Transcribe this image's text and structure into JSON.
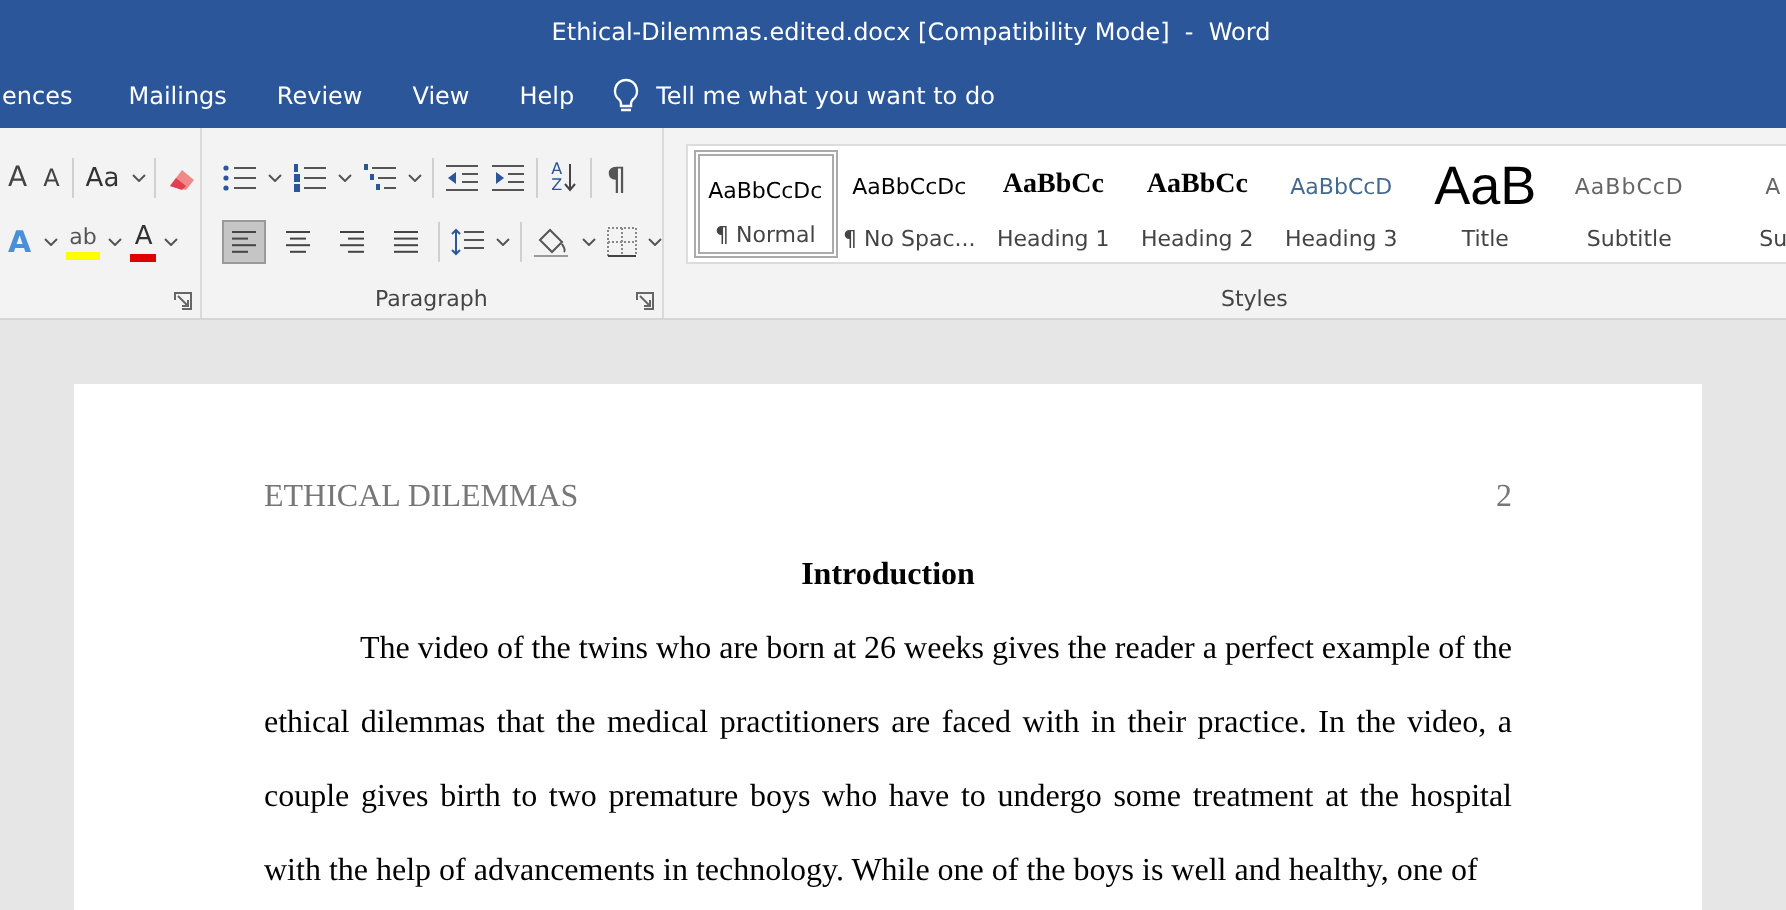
{
  "window": {
    "title": "Ethical-Dilemmas.edited.docx [Compatibility Mode]  -  Word"
  },
  "menu": {
    "tabs": [
      "ences",
      "Mailings",
      "Review",
      "View",
      "Help"
    ],
    "tell_me": "Tell me what you want to do"
  },
  "font_group": {
    "grow_glyph": "A",
    "shrink_glyph": "A",
    "case_label": "Aa",
    "effects_glyph": "A",
    "highlight_glyph": "ab",
    "color_glyph": "A"
  },
  "paragraph_group": {
    "label": "Paragraph",
    "pilcrow": "¶",
    "sort_glyphs": [
      "A",
      "Z"
    ],
    "alignment": [
      {
        "kind": "left",
        "selected": true
      },
      {
        "kind": "center",
        "selected": false
      },
      {
        "kind": "right",
        "selected": false
      },
      {
        "kind": "justify",
        "selected": false
      }
    ]
  },
  "styles_group": {
    "label": "Styles",
    "styles": [
      {
        "preview": "AaBbCcDc",
        "name": "¶ Normal",
        "kind": "normal",
        "selected": true
      },
      {
        "preview": "AaBbCcDc",
        "name": "¶ No Spac...",
        "kind": "normal",
        "selected": false
      },
      {
        "preview": "AaBbCc",
        "name": "Heading 1",
        "kind": "heading1",
        "selected": false
      },
      {
        "preview": "AaBbCc",
        "name": "Heading 2",
        "kind": "heading2",
        "selected": false
      },
      {
        "preview": "AaBbCcD",
        "name": "Heading 3",
        "kind": "heading3",
        "selected": false
      },
      {
        "preview": "AaB",
        "name": "Title",
        "kind": "title",
        "selected": false
      },
      {
        "preview": "AaBbCcD",
        "name": "Subtitle",
        "kind": "subtitle",
        "selected": false
      },
      {
        "preview": "A",
        "name": "Su",
        "kind": "subtitle",
        "selected": false
      }
    ]
  },
  "document": {
    "header": "ETHICAL DILEMMAS",
    "page_number": "2",
    "heading": "Introduction",
    "paragraph": "The video of the twins who are born at 26 weeks gives the reader a perfect example of the ethical dilemmas that the medical practitioners are faced with in their practice. In the video, a couple gives birth to two premature boys who have to undergo some treatment at the hospital with the help of advancements in technology. While one of the boys is well and healthy, one of"
  }
}
